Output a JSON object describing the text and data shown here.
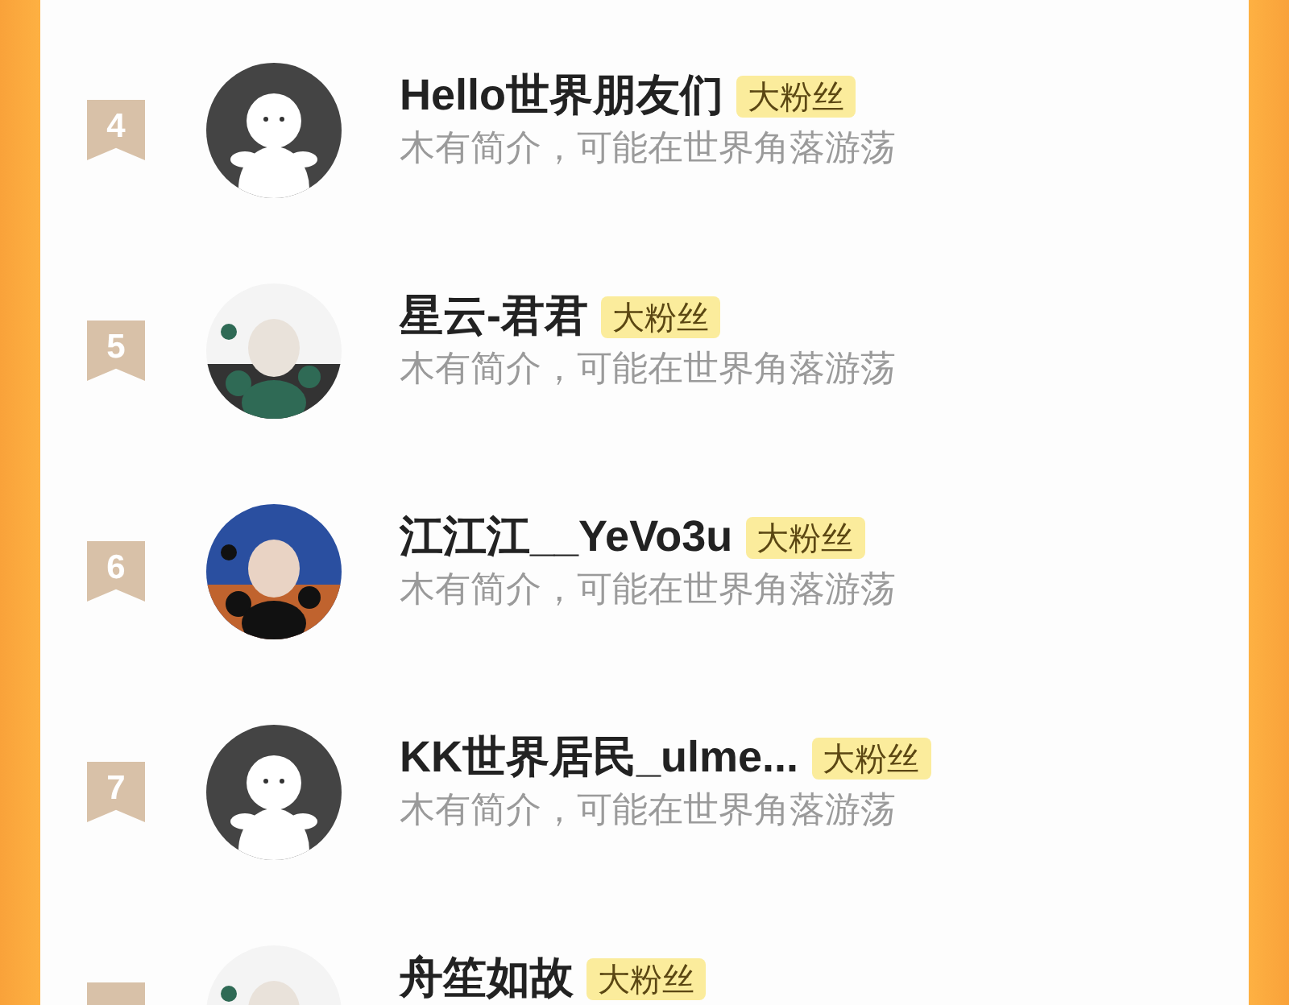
{
  "fans": [
    {
      "rank": "4",
      "name": "Hello世界朋友们",
      "badge": "大粉丝",
      "bio": "木有简介，可能在世界角落游荡",
      "avatar": {
        "kind": "default"
      }
    },
    {
      "rank": "5",
      "name": "星云-君君",
      "badge": "大粉丝",
      "bio": "木有简介，可能在世界角落游荡"
    },
    {
      "rank": "6",
      "name": "江江江__YeVo3u",
      "badge": "大粉丝",
      "bio": "木有简介，可能在世界角落游荡"
    },
    {
      "rank": "7",
      "name": "KK世界居民_ulme...",
      "badge": "大粉丝",
      "bio": "木有简介，可能在世界角落游荡",
      "avatar": {
        "kind": "default"
      }
    },
    {
      "name": "舟笙如故",
      "badge": "大粉丝"
    }
  ]
}
